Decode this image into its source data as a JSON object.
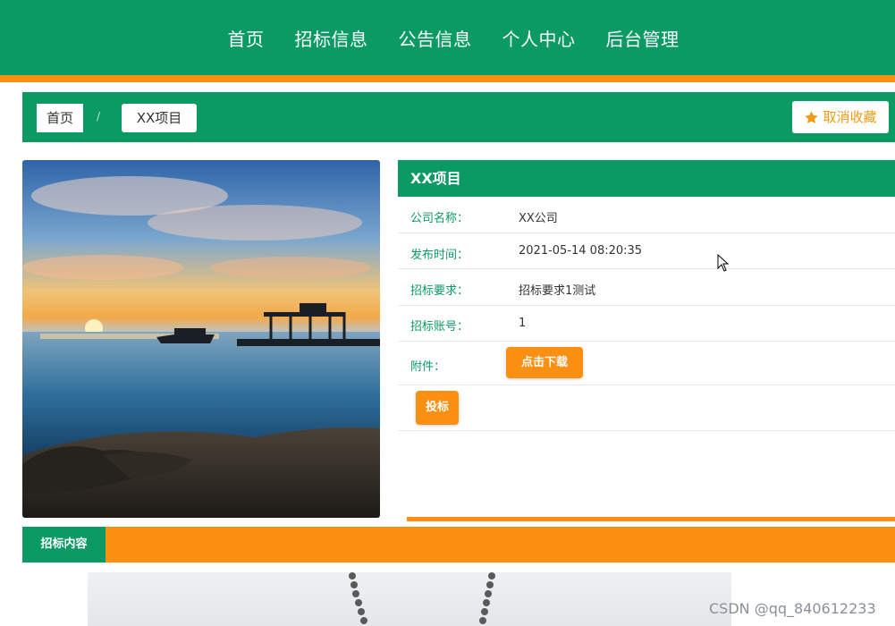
{
  "nav": {
    "items": [
      {
        "label": "首页"
      },
      {
        "label": "招标信息"
      },
      {
        "label": "公告信息"
      },
      {
        "label": "个人中心"
      },
      {
        "label": "后台管理"
      }
    ]
  },
  "breadcrumb": {
    "home": "首页",
    "separator": "/",
    "current": "XX项目",
    "favorite_label": "取消收藏"
  },
  "project": {
    "title": "XX项目",
    "rows": [
      {
        "label": "公司名称：",
        "value": "XX公司"
      },
      {
        "label": "发布时间：",
        "value": "2021-05-14 08:20:35"
      },
      {
        "label": "招标要求：",
        "value": "招标要求1测试"
      },
      {
        "label": "招标账号：",
        "value": "1"
      }
    ],
    "attachment_label": "附件：",
    "download_label": "点击下载",
    "bid_label": "投标"
  },
  "content": {
    "tab_label": "招标内容"
  },
  "watermark": "CSDN @qq_840612233",
  "colors": {
    "primary": "#0b9a63",
    "accent": "#fb8f12"
  }
}
